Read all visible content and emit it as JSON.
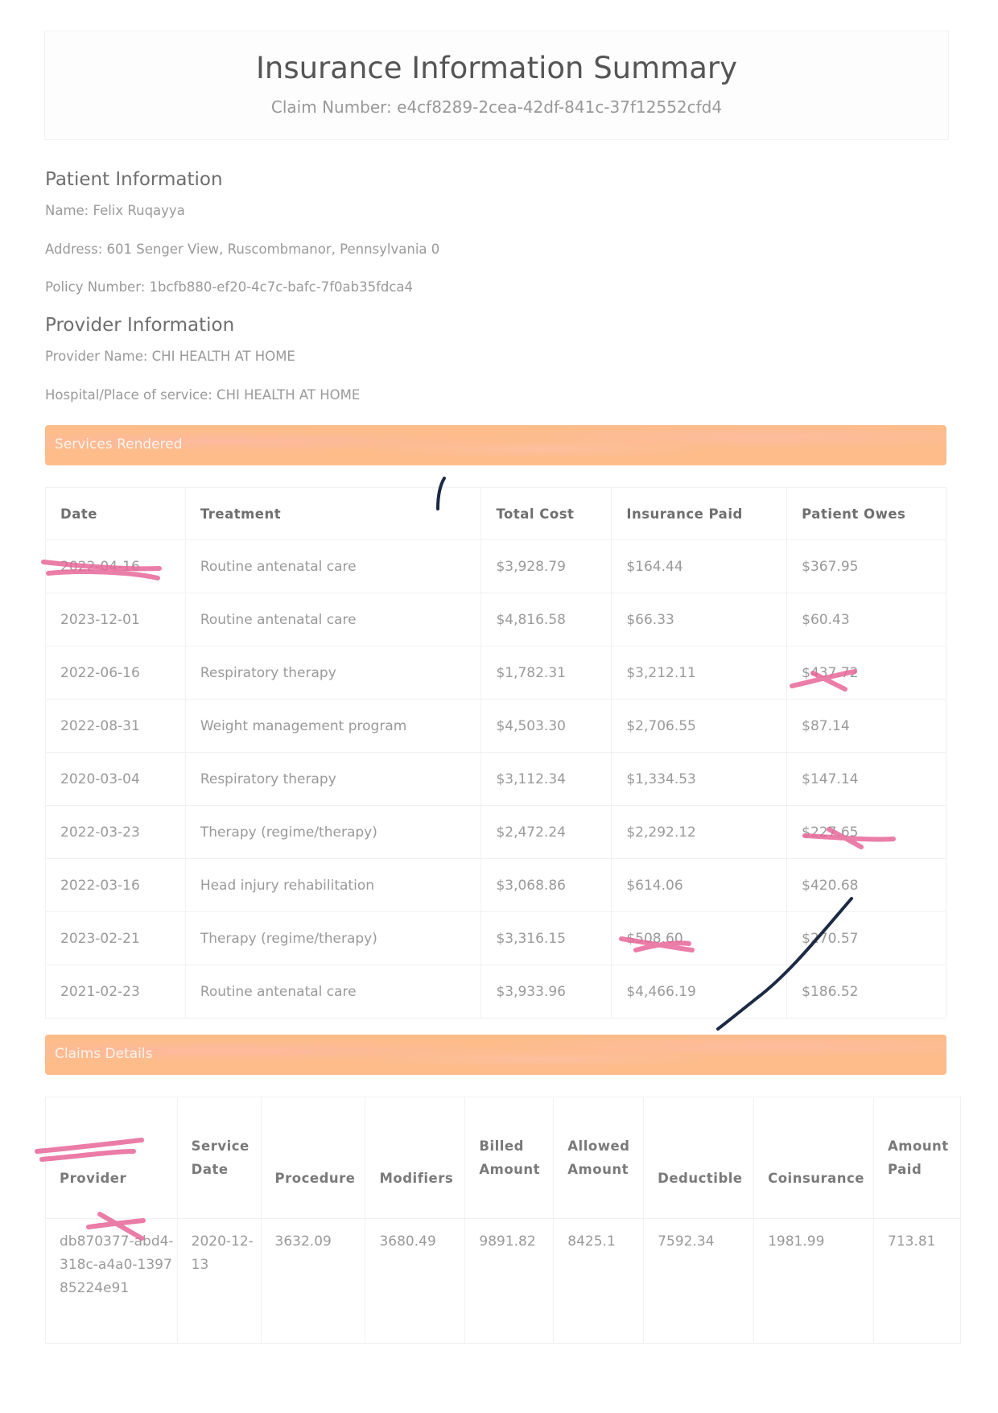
{
  "header": {
    "title": "Insurance Information Summary",
    "claim_number": "Claim Number: e4cf8289-2cea-42df-841c-37f12552cfd4"
  },
  "patient": {
    "heading": "Patient Information",
    "name": "Name: Felix Ruqayya",
    "address": "Address: 601 Senger View, Ruscombmanor, Pennsylvania 0",
    "policy": "Policy Number: 1bcfb880-ef20-4c7c-bafc-7f0ab35fdca4"
  },
  "provider": {
    "heading": "Provider Information",
    "name": "Provider Name: CHI HEALTH AT HOME",
    "place": "Hospital/Place of service: CHI HEALTH AT HOME"
  },
  "services": {
    "band_label": "Services Rendered",
    "columns": [
      "Date",
      "Treatment",
      "Total Cost",
      "Insurance Paid",
      "Patient Owes"
    ],
    "rows": [
      [
        "2022-04-16",
        "Routine antenatal care",
        "$3,928.79",
        "$164.44",
        "$367.95"
      ],
      [
        "2023-12-01",
        "Routine antenatal care",
        "$4,816.58",
        "$66.33",
        "$60.43"
      ],
      [
        "2022-06-16",
        "Respiratory therapy",
        "$1,782.31",
        "$3,212.11",
        "$437.72"
      ],
      [
        "2022-08-31",
        "Weight management program",
        "$4,503.30",
        "$2,706.55",
        "$87.14"
      ],
      [
        "2020-03-04",
        "Respiratory therapy",
        "$3,112.34",
        "$1,334.53",
        "$147.14"
      ],
      [
        "2022-03-23",
        "Therapy (regime/therapy)",
        "$2,472.24",
        "$2,292.12",
        "$227.65"
      ],
      [
        "2022-03-16",
        "Head injury rehabilitation",
        "$3,068.86",
        "$614.06",
        "$420.68"
      ],
      [
        "2023-02-21",
        "Therapy (regime/therapy)",
        "$3,316.15",
        "$508.60",
        "$270.57"
      ],
      [
        "2021-02-23",
        "Routine antenatal care",
        "$3,933.96",
        "$4,466.19",
        "$186.52"
      ]
    ]
  },
  "claims": {
    "band_label": "Claims Details",
    "columns": [
      "Provider",
      "Service Date",
      "Procedure",
      "Modifiers",
      "Billed Amount",
      "Allowed Amount",
      "Deductible",
      "Coinsurance",
      "Amount Paid"
    ],
    "rows": [
      [
        "db870377-abd4-318c-a4a0-139785224e91",
        "2020-12-13",
        "3632.09",
        "3680.49",
        "9891.82",
        "8425.1",
        "7592.34",
        "1981.99",
        "713.81"
      ]
    ]
  },
  "annotations": {
    "pink_color": "#e8669a",
    "ink_color": "#1c2a44"
  }
}
